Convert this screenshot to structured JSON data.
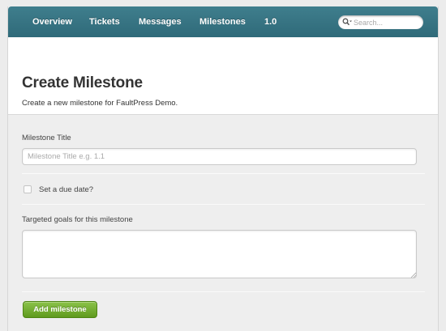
{
  "nav": {
    "items": [
      {
        "label": "Overview"
      },
      {
        "label": "Tickets"
      },
      {
        "label": "Messages"
      },
      {
        "label": "Milestones"
      },
      {
        "label": "1.0"
      }
    ],
    "search": {
      "placeholder": "Search...",
      "value": ""
    }
  },
  "header": {
    "title": "Create Milestone",
    "subtitle": "Create a new milestone for FaultPress Demo."
  },
  "form": {
    "title_label": "Milestone Title",
    "title_placeholder": "Milestone Title e.g. 1.1",
    "title_value": "",
    "due_date_label": "Set a due date?",
    "due_date_checked": false,
    "goals_label": "Targeted goals for this milestone",
    "goals_value": "",
    "submit_label": "Add milestone"
  },
  "colors": {
    "navbar": "#2f6a79",
    "submit_button": "#6aa62a",
    "page_background": "#eeeeee"
  },
  "icons": {
    "search": "search-icon",
    "resize": "resize-grip-icon"
  }
}
